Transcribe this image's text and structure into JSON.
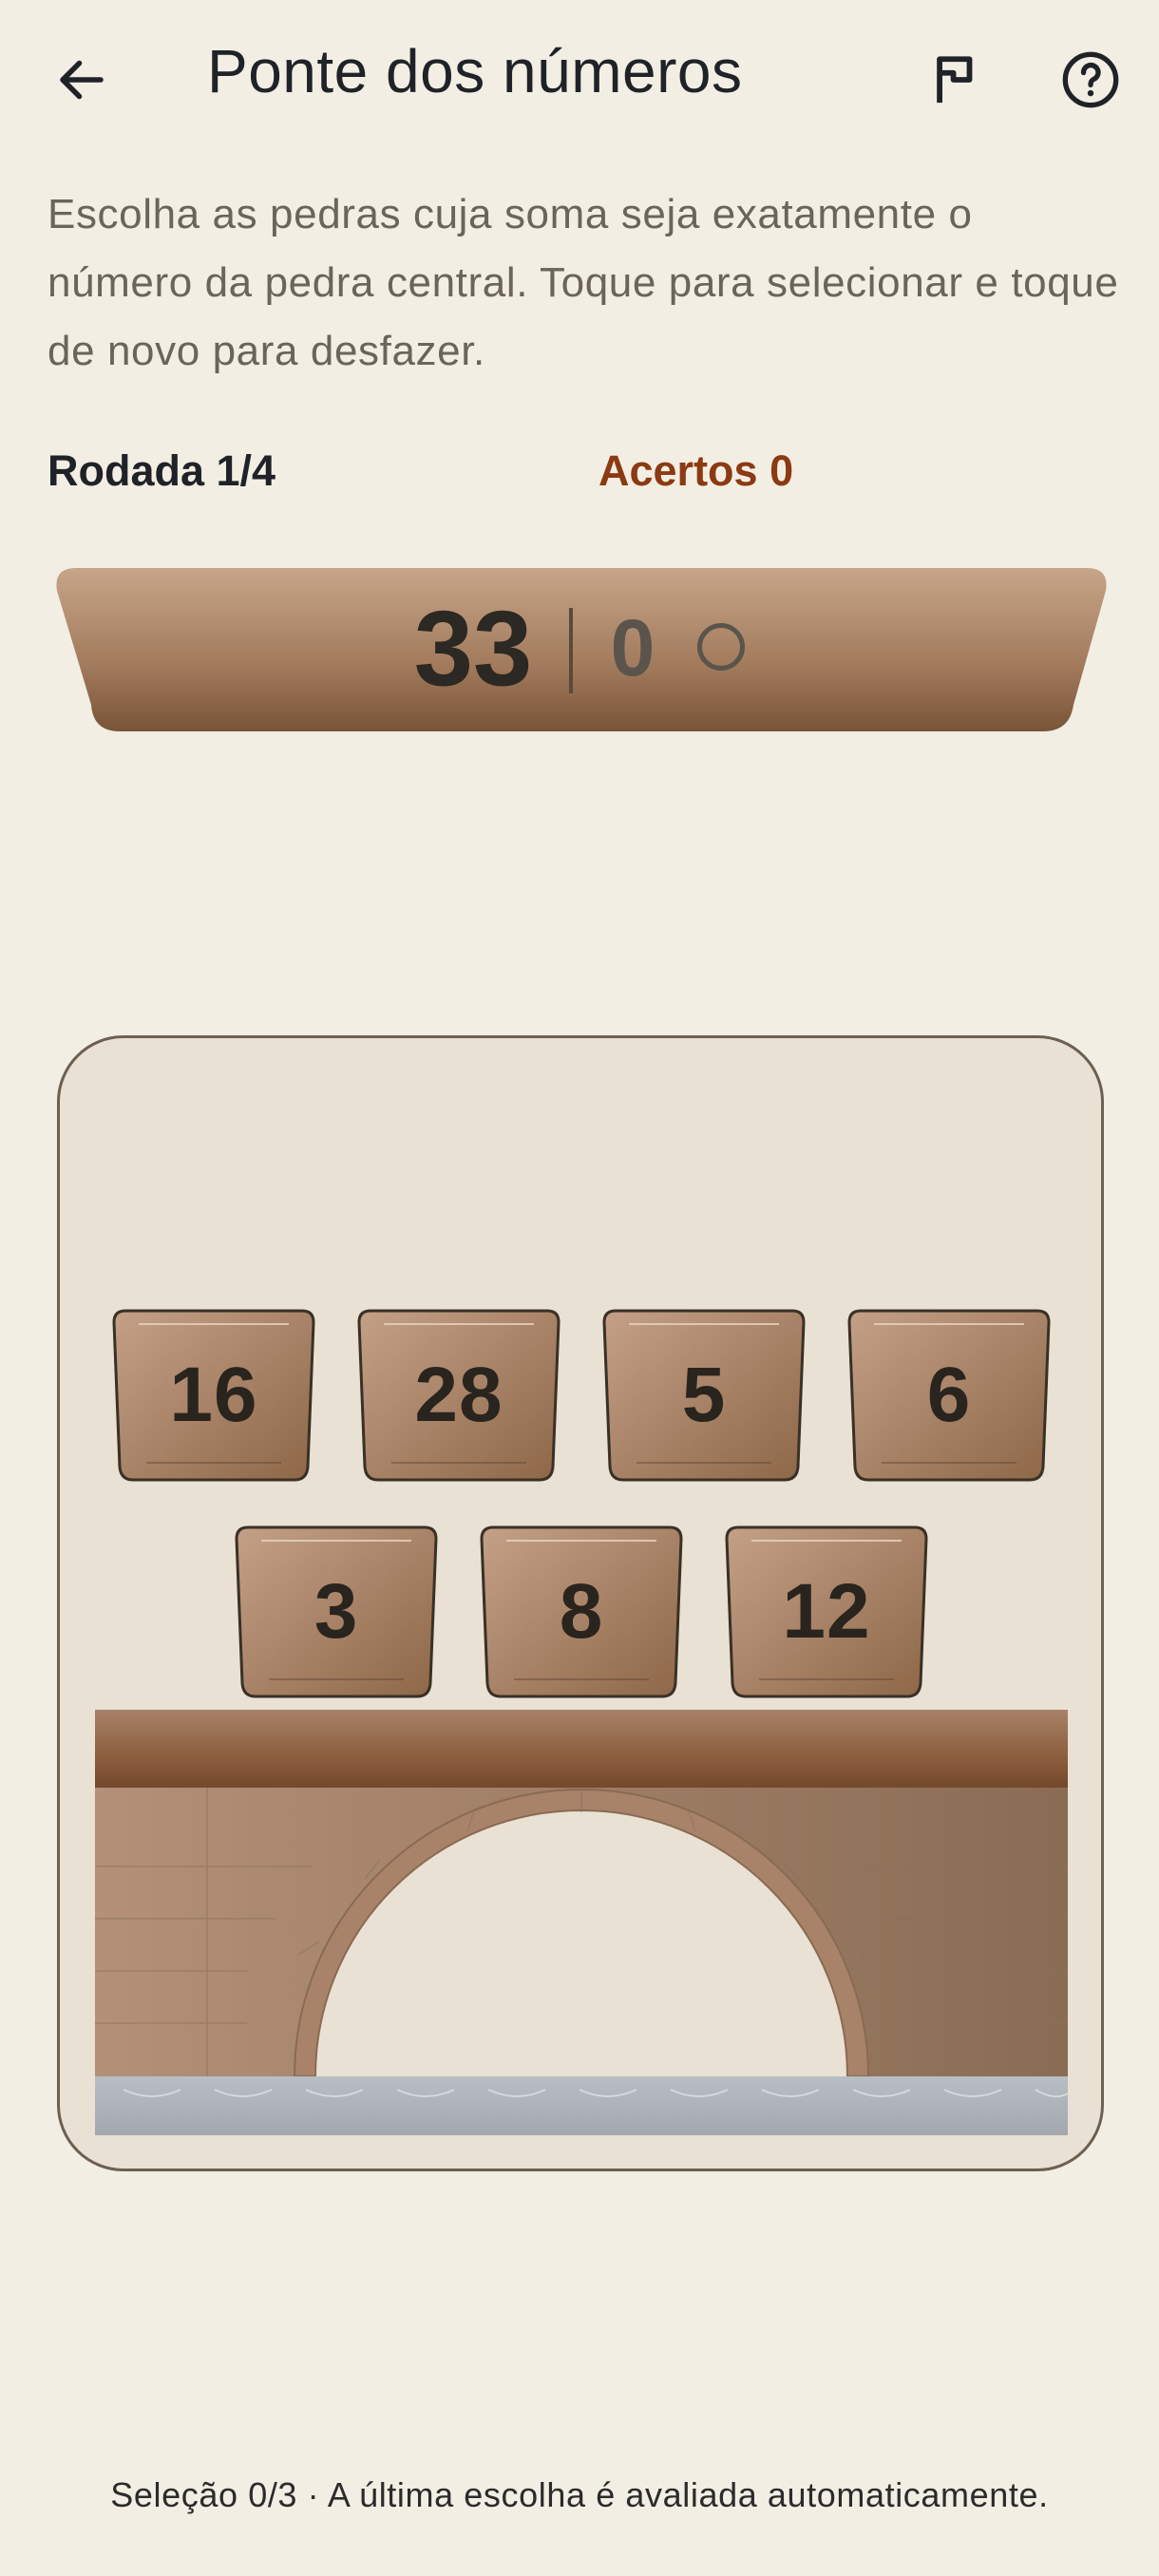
{
  "header": {
    "title": "Ponte dos números",
    "back_icon": "arrow-left-icon",
    "flag_icon": "flag-icon",
    "help_icon": "help-circle-icon"
  },
  "instructions": "Escolha as pedras cuja soma seja exatamente o número da pedra central. Toque para selecionar e toque de novo para desfazer.",
  "status": {
    "round": "Rodada 1/4",
    "score": "Acertos 0"
  },
  "target": {
    "number": "33",
    "current_sum": "0"
  },
  "stones": [
    {
      "value": "16"
    },
    {
      "value": "28"
    },
    {
      "value": "5"
    },
    {
      "value": "6"
    },
    {
      "value": "3"
    },
    {
      "value": "8"
    },
    {
      "value": "12"
    }
  ],
  "footer": "Seleção 0/3 · A última escolha é avaliada automaticamente.",
  "colors": {
    "background": "#f3eee4",
    "accent": "#8b3a12",
    "stone": "#a97e61",
    "board": "#e9e1d4"
  }
}
